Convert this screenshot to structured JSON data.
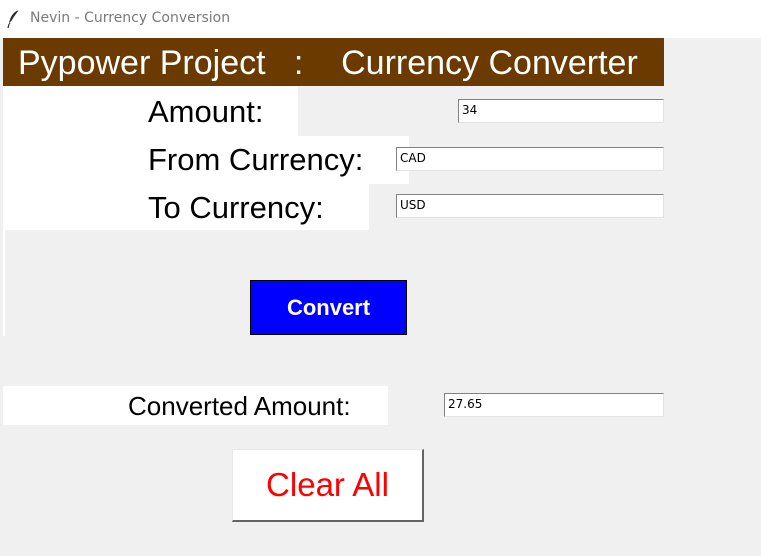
{
  "window": {
    "title": "Nevin - Currency Conversion",
    "icon": "feather-icon"
  },
  "header": {
    "title": "Pypower Project   :    Currency Converter"
  },
  "form": {
    "amount_label": "Amount:",
    "amount_value": "34",
    "from_label": "From Currency:",
    "from_value": "CAD",
    "to_label": "To Currency:",
    "to_value": "USD"
  },
  "actions": {
    "convert_label": "Convert",
    "clear_label": "Clear All"
  },
  "result": {
    "label": "Converted Amount:",
    "value": "27.65"
  },
  "colors": {
    "header_bg": "#6b3a00",
    "convert_bg": "#0000ff",
    "clear_text": "#ff0000",
    "window_bg": "#f0f0f0"
  }
}
